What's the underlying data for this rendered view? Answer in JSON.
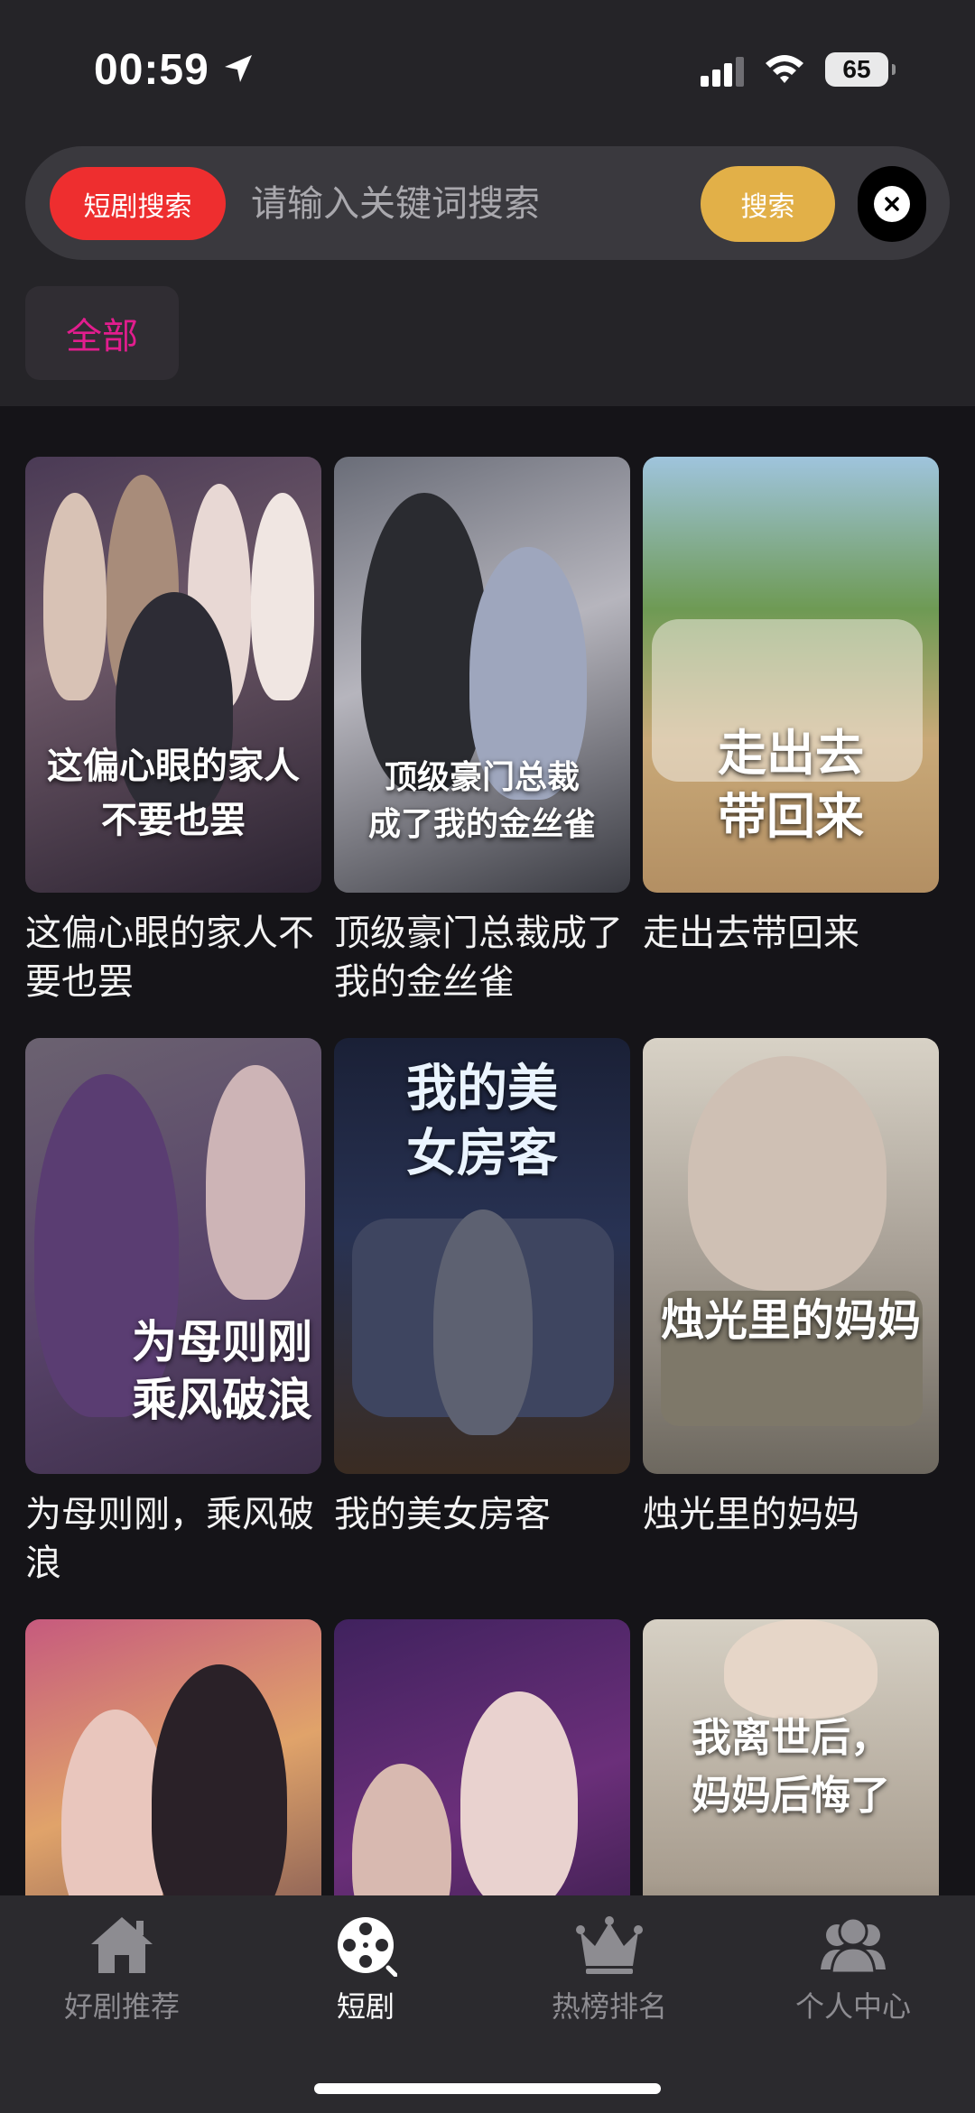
{
  "status_bar": {
    "time": "00:59",
    "battery": "65",
    "icons": [
      "location-arrow-icon",
      "cellular-signal-icon",
      "wifi-icon",
      "battery-icon"
    ]
  },
  "search": {
    "tag_label": "短剧搜索",
    "placeholder": "请输入关键词搜索",
    "value": "",
    "button_label": "搜索",
    "close_icon": "close-circle-icon"
  },
  "categories": [
    {
      "label": "全部",
      "selected": true
    }
  ],
  "dramas": [
    {
      "title": "这偏心眼的家人不要也罢",
      "poster_text": "这偏心眼的家人 不要也罢"
    },
    {
      "title": "顶级豪门总裁成了我的金丝雀",
      "poster_text": "顶级豪门总裁 成了我的金丝雀"
    },
    {
      "title": "走出去带回来",
      "poster_text": "走出去 带回来"
    },
    {
      "title": "为母则刚，乘风破浪",
      "poster_text": "为母则刚 乘风破浪"
    },
    {
      "title": "我的美女房客",
      "poster_text": "我的美 女房客"
    },
    {
      "title": "烛光里的妈妈",
      "poster_text": "烛光里的妈妈"
    },
    {
      "title": "",
      "poster_text": ""
    },
    {
      "title": "",
      "poster_text": ""
    },
    {
      "title": "",
      "poster_text": "我离世后， 妈妈后悔了"
    }
  ],
  "tabs": [
    {
      "label": "好剧推荐",
      "icon": "home-icon",
      "active": false
    },
    {
      "label": "短剧",
      "icon": "film-reel-icon",
      "active": true
    },
    {
      "label": "热榜排名",
      "icon": "crown-icon",
      "active": false
    },
    {
      "label": "个人中心",
      "icon": "users-icon",
      "active": false
    }
  ],
  "colors": {
    "background": "#151418",
    "header": "#252428",
    "tag_red": "#ee2e2f",
    "search_button_gold": "#e2b048",
    "category_pink": "#e21d8e",
    "tab_active": "#ffffff",
    "tab_inactive": "#8d8c91"
  }
}
